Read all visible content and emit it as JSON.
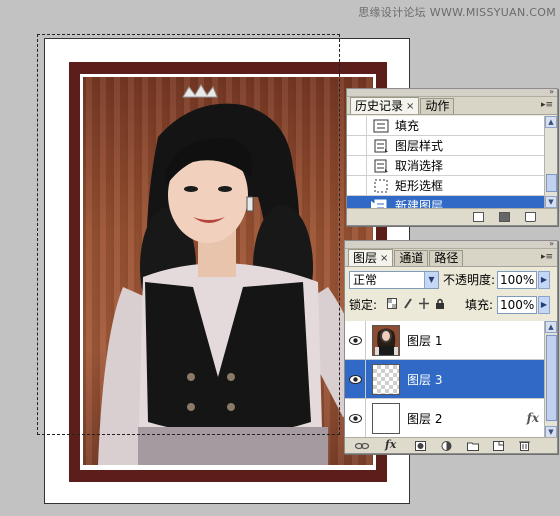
{
  "watermark": "思缘设计论坛 WWW.MISSYUAN.COM",
  "history_panel": {
    "tabs": [
      {
        "label": "历史记录",
        "active": true,
        "closable": true
      },
      {
        "label": "动作",
        "active": false,
        "closable": false
      }
    ],
    "items": [
      {
        "label": "填充",
        "icon": "fill-icon",
        "selected": false
      },
      {
        "label": "图层样式",
        "icon": "layer-style-icon",
        "selected": false
      },
      {
        "label": "取消选择",
        "icon": "deselect-icon",
        "selected": false
      },
      {
        "label": "矩形选框",
        "icon": "rect-marquee-icon",
        "selected": false
      },
      {
        "label": "新建图层",
        "icon": "new-layer-icon",
        "selected": true
      }
    ],
    "footer_icons": [
      "new-document-from-state-icon",
      "snapshot-icon",
      "trash-icon"
    ]
  },
  "layers_panel": {
    "tabs": [
      {
        "label": "图层",
        "active": true,
        "closable": true
      },
      {
        "label": "通道",
        "active": false,
        "closable": false
      },
      {
        "label": "路径",
        "active": false,
        "closable": false
      }
    ],
    "blend_mode": "正常",
    "opacity_label": "不透明度:",
    "opacity_value": "100%",
    "lock_label": "锁定:",
    "fill_label": "填充:",
    "fill_value": "100%",
    "layers": [
      {
        "name": "图层 1",
        "visible": true,
        "selected": false,
        "thumb": "photo",
        "fx": false
      },
      {
        "name": "图层 3",
        "visible": true,
        "selected": true,
        "thumb": "transparent",
        "fx": false
      },
      {
        "name": "图层 2",
        "visible": true,
        "selected": false,
        "thumb": "white",
        "fx": true
      }
    ],
    "fx_symbol": "fx",
    "footer_icons": [
      "link-icon",
      "fx-icon",
      "mask-icon",
      "adjustment-icon",
      "group-icon",
      "new-layer-icon",
      "trash-icon"
    ]
  }
}
